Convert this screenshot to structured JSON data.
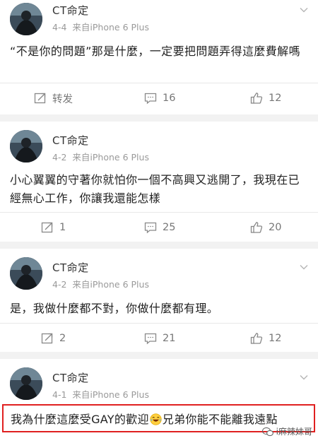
{
  "posts": [
    {
      "author": "CT命定",
      "date": "4-4",
      "source": "来自iPhone 6 Plus",
      "content": "“不是你的問題”那是什麼，一定要把問題弄得這麼費解嗎",
      "repost_label": "转发",
      "comments": "16",
      "likes": "12"
    },
    {
      "author": "CT命定",
      "date": "4-2",
      "source": "来自iPhone 6 Plus",
      "content": "小心翼翼的守著你就怕你一個不高興又逃開了，我現在已經無心工作，你讓我還能怎樣",
      "reposts": "1",
      "comments": "25",
      "likes": "20"
    },
    {
      "author": "CT命定",
      "date": "4-2",
      "source": "来自iPhone 6 Plus",
      "content": "是，我做什麼都不對，你做什麼都有理。",
      "reposts": "2",
      "comments": "21",
      "likes": "12"
    },
    {
      "author": "CT命定",
      "date": "4-1",
      "source": "来自iPhone 6 Plus",
      "content_before": "我為什麼這麼受GAY的歡迎",
      "content_after": "兄弟你能不能離我遠點"
    }
  ],
  "icons": {
    "repost": "repost-icon",
    "comment": "comment-icon",
    "like": "thumbs-up-icon",
    "emoji": "laughing-tears-emoji",
    "menu": "chevron-down-icon"
  },
  "watermark": "i麻辣妹哥",
  "colors": {
    "highlight_border": "#e02020",
    "text": "#222222",
    "meta": "#9a9a9a",
    "background": "#f2f2f2"
  }
}
